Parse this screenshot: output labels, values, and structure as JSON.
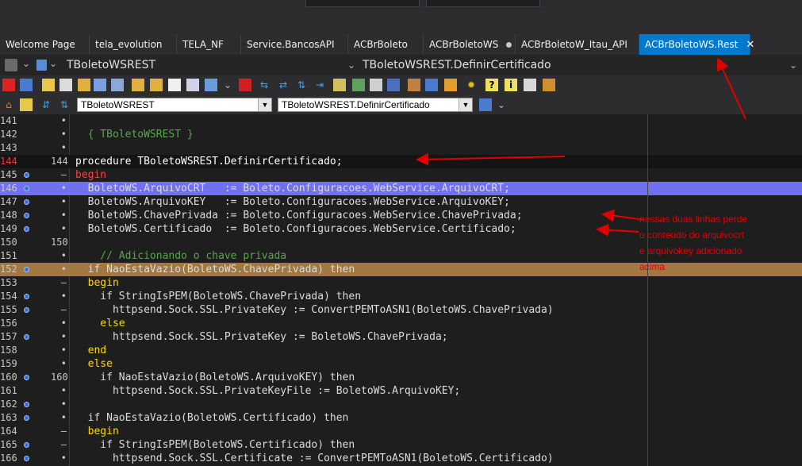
{
  "tabs": [
    {
      "label": "Welcome Page"
    },
    {
      "label": "tela_evolution"
    },
    {
      "label": "TELA_NF"
    },
    {
      "label": "Service.BancosAPI"
    },
    {
      "label": "ACBrBoleto"
    },
    {
      "label": "ACBrBoletoWS"
    },
    {
      "label": "ACBrBoletoW_Itau_API"
    },
    {
      "label": "ACBrBoletoWS.Rest",
      "close": "✕"
    }
  ],
  "classrow": {
    "class_name": "TBoletoWSREST",
    "method_name": "TBoletoWSREST.DefinirCertificado",
    "chevron": "⌄"
  },
  "toolbar2": {
    "class_combo": "TBoletoWSREST",
    "method_combo": "TBoletoWSREST.DefinirCertificado"
  },
  "lines": [
    {
      "num": "141",
      "mark": "•",
      "code": ""
    },
    {
      "num": "142",
      "mark": "•",
      "code": "  { TBoletoWSREST }"
    },
    {
      "num": "143",
      "mark": "•",
      "code": ""
    },
    {
      "num": "144",
      "mark": "144",
      "code": "procedure TBoletoWSREST.DefinirCertificado;"
    },
    {
      "num": "145",
      "mark": "–",
      "code": "begin"
    },
    {
      "num": "146",
      "mark": "•",
      "code": "  BoletoWS.ArquivoCRT   := Boleto.Configuracoes.WebService.ArquivoCRT;"
    },
    {
      "num": "147",
      "mark": "•",
      "code": "  BoletoWS.ArquivoKEY   := Boleto.Configuracoes.WebService.ArquivoKEY;"
    },
    {
      "num": "148",
      "mark": "•",
      "code": "  BoletoWS.ChavePrivada := Boleto.Configuracoes.WebService.ChavePrivada;"
    },
    {
      "num": "149",
      "mark": "•",
      "code": "  BoletoWS.Certificado  := Boleto.Configuracoes.WebService.Certificado;"
    },
    {
      "num": "150",
      "mark": "150",
      "code": ""
    },
    {
      "num": "151",
      "mark": "•",
      "code": "    // Adicionando o chave privada"
    },
    {
      "num": "152",
      "mark": "•",
      "code": "  if NaoEstaVazio(BoletoWS.ChavePrivada) then"
    },
    {
      "num": "153",
      "mark": "–",
      "code": "  begin"
    },
    {
      "num": "154",
      "mark": "•",
      "code": "    if StringIsPEM(BoletoWS.ChavePrivada) then"
    },
    {
      "num": "155",
      "mark": "–",
      "code": "      httpsend.Sock.SSL.PrivateKey := ConvertPEMToASN1(BoletoWS.ChavePrivada)"
    },
    {
      "num": "156",
      "mark": "•",
      "code": "    else"
    },
    {
      "num": "157",
      "mark": "•",
      "code": "      httpsend.Sock.SSL.PrivateKey := BoletoWS.ChavePrivada;"
    },
    {
      "num": "158",
      "mark": "•",
      "code": "  end"
    },
    {
      "num": "159",
      "mark": "•",
      "code": "  else"
    },
    {
      "num": "160",
      "mark": "160",
      "code": "    if NaoEstaVazio(BoletoWS.ArquivoKEY) then"
    },
    {
      "num": "161",
      "mark": "•",
      "code": "      httpsend.Sock.SSL.PrivateKeyFile := BoletoWS.ArquivoKEY;"
    },
    {
      "num": "162",
      "mark": "•",
      "code": ""
    },
    {
      "num": "163",
      "mark": "•",
      "code": "  if NaoEstaVazio(BoletoWS.Certificado) then"
    },
    {
      "num": "164",
      "mark": "–",
      "code": "  begin"
    },
    {
      "num": "165",
      "mark": "–",
      "code": "    if StringIsPEM(BoletoWS.Certificado) then"
    },
    {
      "num": "166",
      "mark": "•",
      "code": "      httpsend.Sock.SSL.Certificate := ConvertPEMToASN1(BoletoWS.Certificado)"
    }
  ],
  "annotation": {
    "line1": "nessas duas linhas perde",
    "line2": "o conteudo do arquivocrt",
    "line3": "e arquivokey adicionado",
    "line4": "acima"
  },
  "colors": {
    "accent": "#007acc",
    "highlight_blue": "#7070f0",
    "highlight_orange": "#a07840",
    "annotation_red": "#e00000"
  }
}
